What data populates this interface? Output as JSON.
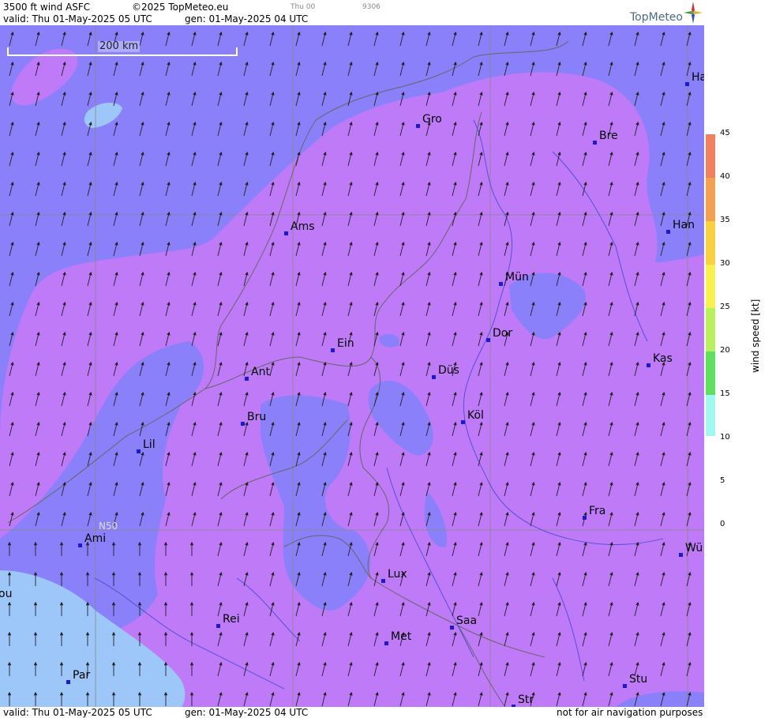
{
  "header": {
    "title": "3500 ft wind ASFC",
    "copyright": "©2025 TopMeteo.eu",
    "run_label": "Thu 00",
    "code": "9306",
    "valid": "valid:  Thu  01-May-2025  05 UTC",
    "gen": "gen: 01-May-2025 04 UTC",
    "logo": "TopMeteo"
  },
  "footer": {
    "valid": "valid:  Thu  01-May-2025  05 UTC",
    "gen": "gen: 01-May-2025 04 UTC",
    "disclaimer": "not for air navigation purposes"
  },
  "map": {
    "scale_label": "200 km",
    "lat_label": "N50",
    "cities": [
      {
        "name": "Ha"
      },
      {
        "name": "Gro"
      },
      {
        "name": "Bre"
      },
      {
        "name": "Ams"
      },
      {
        "name": "Han"
      },
      {
        "name": "Mün"
      },
      {
        "name": "Dor"
      },
      {
        "name": "Ein"
      },
      {
        "name": "Kas"
      },
      {
        "name": "Ant"
      },
      {
        "name": "Düs"
      },
      {
        "name": "Bru"
      },
      {
        "name": "Köl"
      },
      {
        "name": "Lil"
      },
      {
        "name": "Fra"
      },
      {
        "name": "Ami"
      },
      {
        "name": "Wü"
      },
      {
        "name": "ou"
      },
      {
        "name": "Lux"
      },
      {
        "name": "Rei"
      },
      {
        "name": "Saa"
      },
      {
        "name": "Met"
      },
      {
        "name": "Par"
      },
      {
        "name": "Stu"
      },
      {
        "name": "Str"
      }
    ]
  },
  "legend": {
    "label": "wind  speed  [kt]",
    "ticks": [
      "45",
      "40",
      "35",
      "30",
      "25",
      "20",
      "15",
      "10",
      "5",
      "0"
    ],
    "colors": [
      "#f08060",
      "#f4a050",
      "#f8d040",
      "#f8f050",
      "#b8f060",
      "#60e060",
      "#a0f8f0",
      "#a0c8f8",
      "#7f7ff5",
      "#c080f5"
    ]
  },
  "colors": {
    "violet": "#bf7af8",
    "blue_violet": "#8a80fa",
    "light_blue": "#9dc7f8"
  }
}
